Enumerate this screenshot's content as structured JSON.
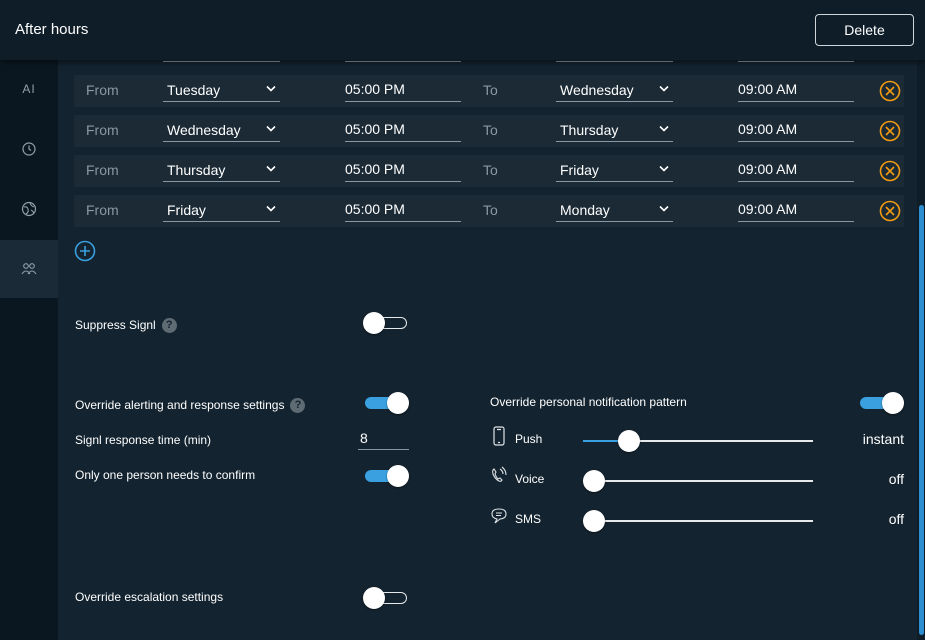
{
  "header": {
    "title": "After hours",
    "delete_label": "Delete"
  },
  "sidebar": {
    "items": [
      {
        "icon": "ai-icon",
        "label": "AI"
      },
      {
        "icon": "clock-icon"
      },
      {
        "icon": "globe-icon"
      },
      {
        "icon": "people-icon",
        "active": true
      }
    ]
  },
  "schedule": {
    "from_label": "From",
    "to_label": "To",
    "rows": [
      {
        "from_day": "Tuesday",
        "from_time": "05:00 PM",
        "to_day": "Wednesday",
        "to_time": "09:00 AM"
      },
      {
        "from_day": "Wednesday",
        "from_time": "05:00 PM",
        "to_day": "Thursday",
        "to_time": "09:00 AM"
      },
      {
        "from_day": "Thursday",
        "from_time": "05:00 PM",
        "to_day": "Friday",
        "to_time": "09:00 AM"
      },
      {
        "from_day": "Friday",
        "from_time": "05:00 PM",
        "to_day": "Monday",
        "to_time": "09:00 AM"
      }
    ]
  },
  "settings": {
    "suppress_signl": {
      "label": "Suppress Signl",
      "on": false
    },
    "override_alerting": {
      "label": "Override alerting and response settings",
      "on": true
    },
    "response_time": {
      "label": "Signl response time (min)",
      "value": "8"
    },
    "one_person": {
      "label": "Only one person needs to confirm",
      "on": true
    },
    "override_escalation": {
      "label": "Override escalation settings",
      "on": false
    },
    "help_glyph": "?"
  },
  "notification_pattern": {
    "label": "Override personal notification pattern",
    "on": true,
    "channels": [
      {
        "icon": "phone-icon",
        "label": "Push",
        "value": "instant",
        "level": 0.17
      },
      {
        "icon": "voice-icon",
        "label": "Voice",
        "value": "off",
        "level": 0
      },
      {
        "icon": "sms-icon",
        "label": "SMS",
        "value": "off",
        "level": 0
      }
    ]
  },
  "colors": {
    "accent": "#3aa0e0",
    "remove": "#f39c12",
    "background": "#13232f",
    "row": "#1b2a35"
  }
}
